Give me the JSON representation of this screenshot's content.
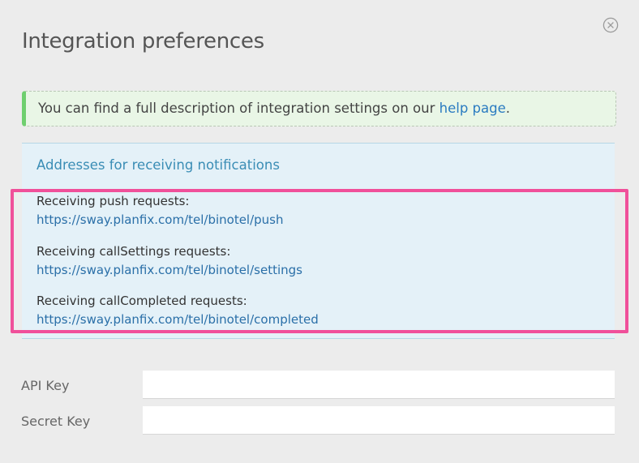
{
  "dialog": {
    "title": "Integration preferences",
    "close_icon": "close-circle-icon"
  },
  "info": {
    "text_before": "You can find a full description of integration settings on our ",
    "link_text": "help page",
    "text_after": ".",
    "accent_color": "#6fcf6f"
  },
  "notifications": {
    "heading": "Addresses for receiving notifications",
    "items": [
      {
        "label": "Receiving push requests:",
        "url": "https://sway.planfix.com/tel/binotel/push"
      },
      {
        "label": "Receiving callSettings requests:",
        "url": "https://sway.planfix.com/tel/binotel/settings"
      },
      {
        "label": "Receiving callCompleted requests:",
        "url": "https://sway.planfix.com/tel/binotel/completed"
      }
    ],
    "highlight_color": "#f0509a"
  },
  "fields": {
    "api_key": {
      "label": "API Key",
      "value": ""
    },
    "secret_key": {
      "label": "Secret Key",
      "value": ""
    }
  }
}
